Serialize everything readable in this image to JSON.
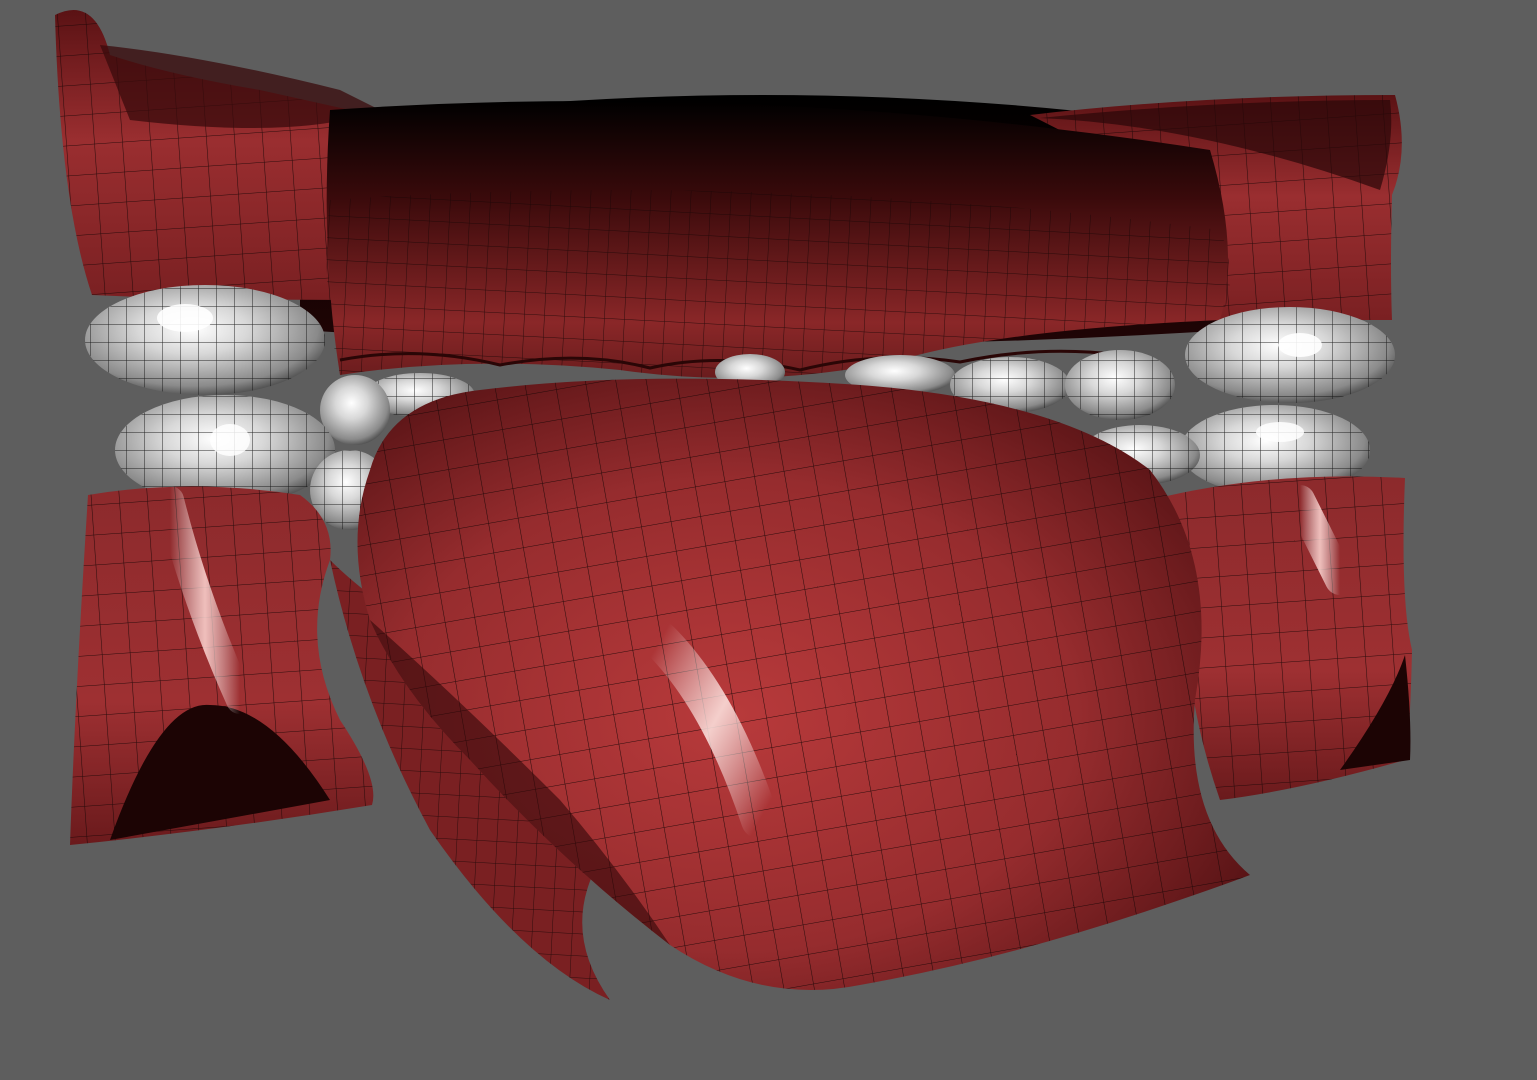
{
  "viewport": {
    "background_color": "#5e5e5e",
    "render_mode": "smooth-shaded-with-wireframe",
    "wire_color": "#1a0606"
  },
  "model": {
    "flesh_color": "#9a2e30",
    "flesh_highlight": "#ffe0dc",
    "flesh_shadow": "#1c0404",
    "teeth_color": "#c8c8c8",
    "teeth_highlight": "#ffffff",
    "teeth_shadow": "#3a3a3a",
    "parts": [
      "upper-lip",
      "upper-gums",
      "upper-teeth",
      "lower-teeth",
      "lower-lip",
      "tongue"
    ]
  }
}
